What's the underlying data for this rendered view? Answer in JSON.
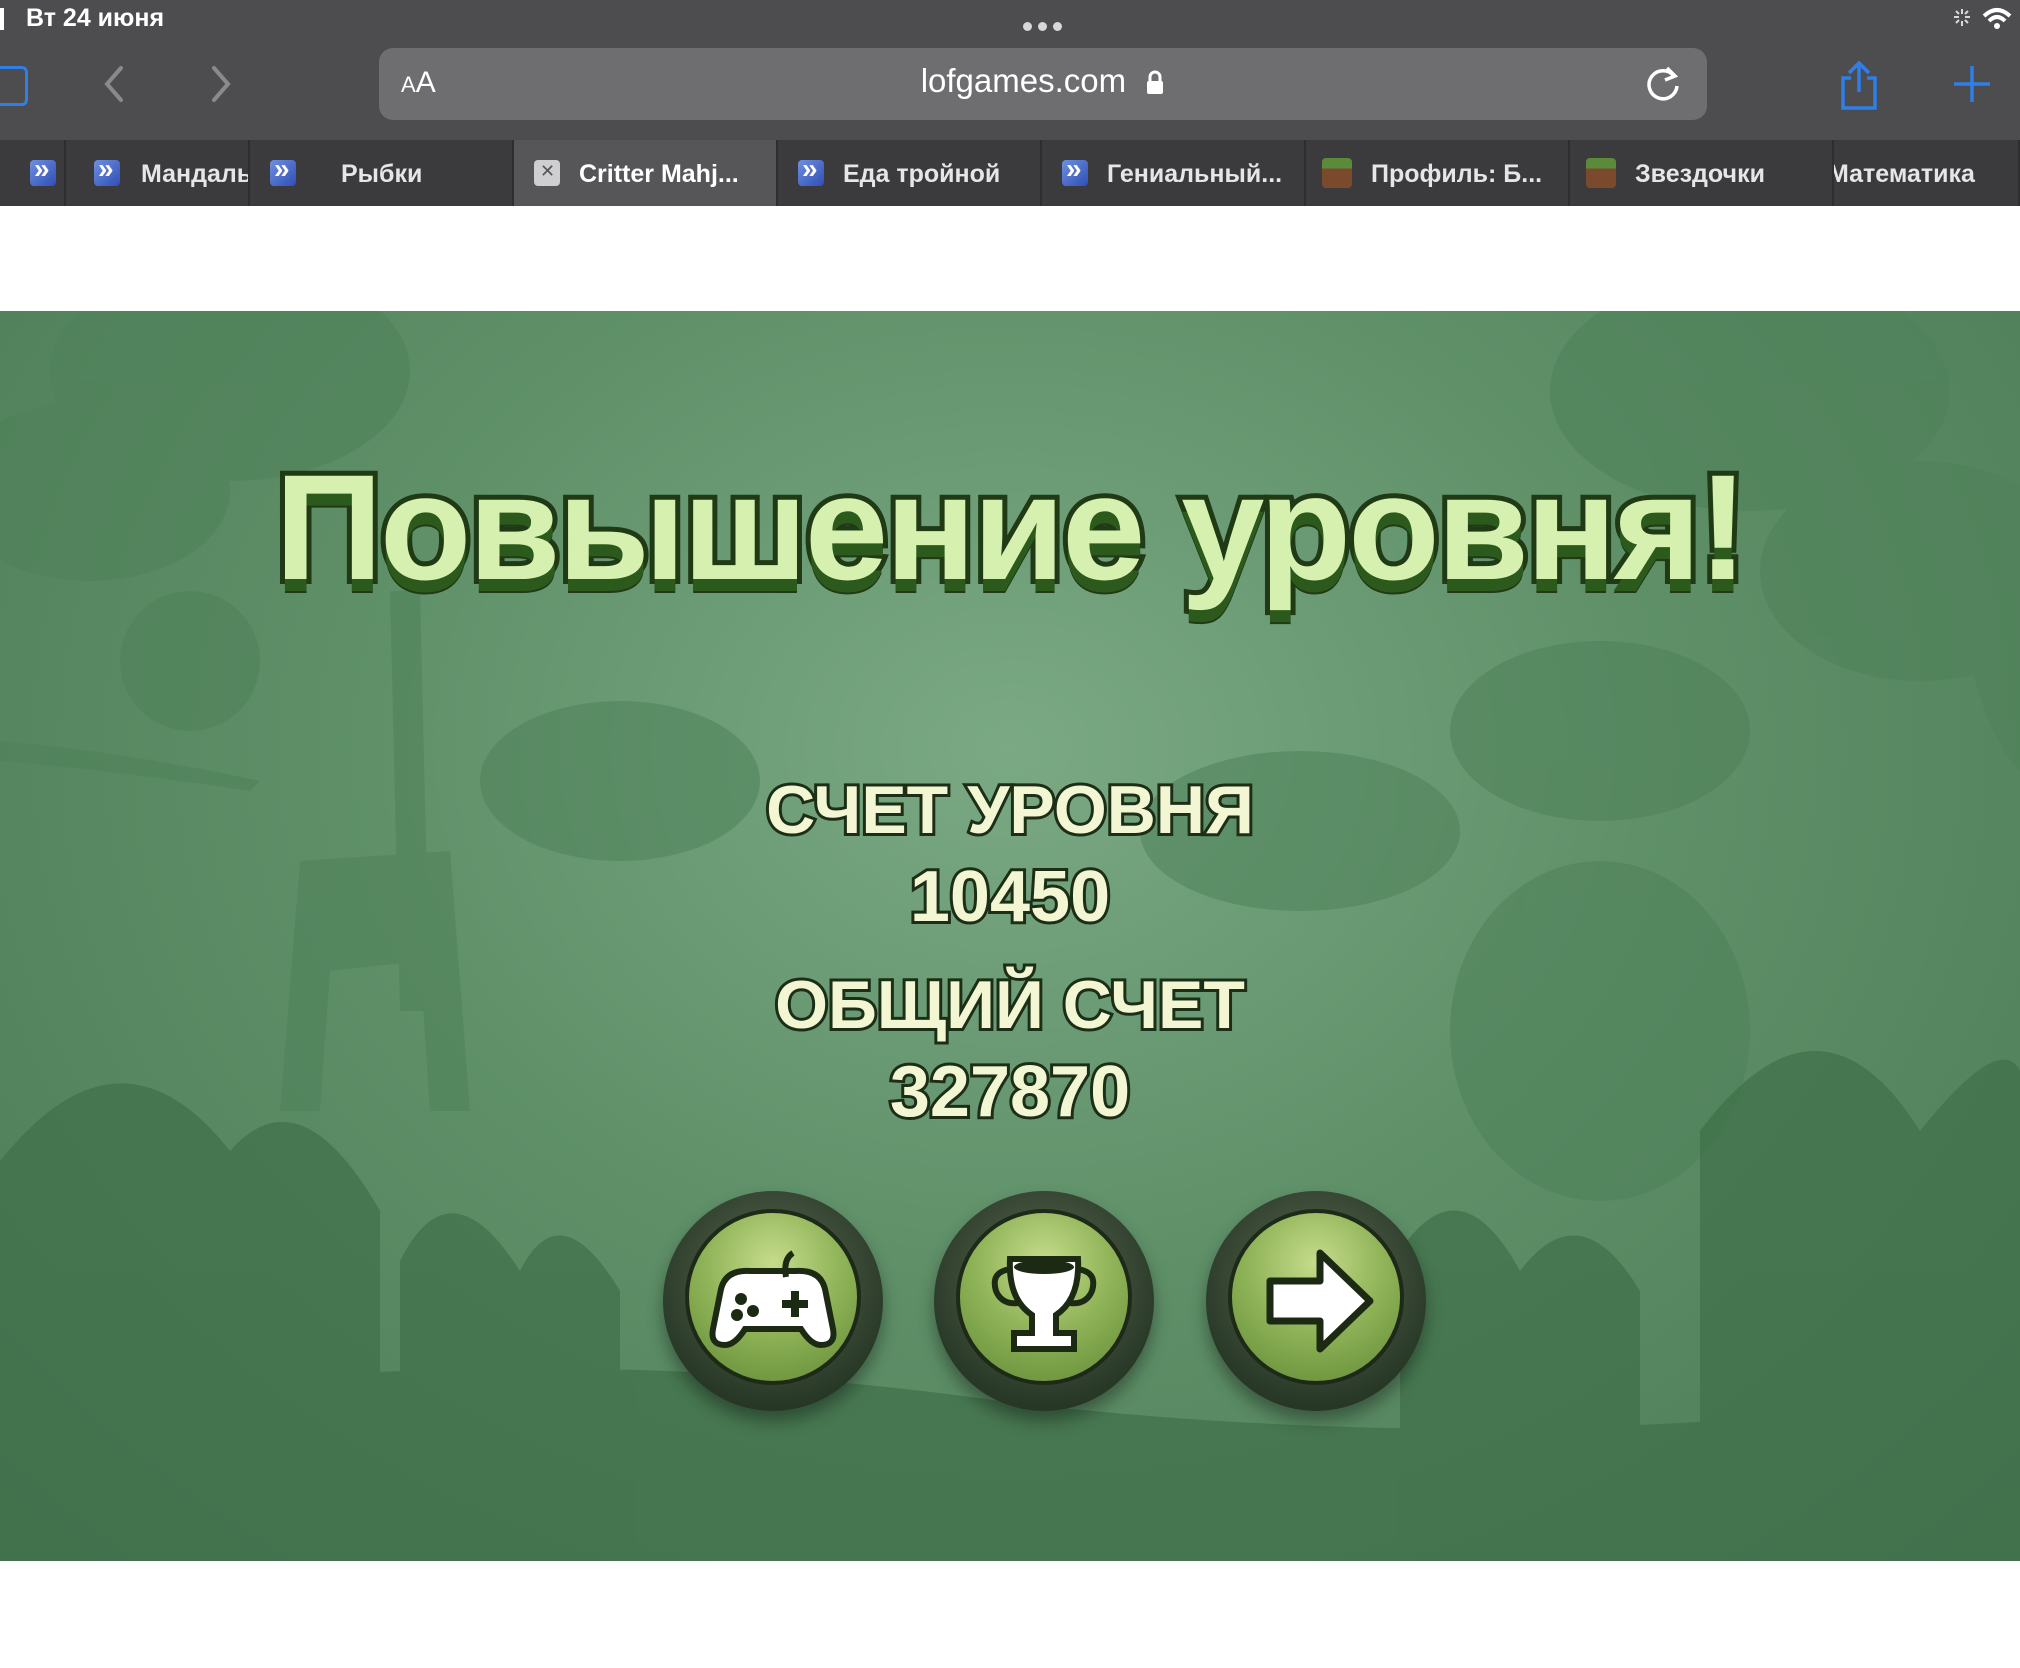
{
  "status_bar": {
    "date": "Вт 24 июня"
  },
  "toolbar": {
    "reader_label_small": "A",
    "reader_label_large": "A",
    "url": "lofgames.com"
  },
  "tabs": [
    {
      "label": "",
      "icon": "game-blue-icon"
    },
    {
      "label": "Мандаль",
      "icon": "game-blue-icon"
    },
    {
      "label": "Рыбки",
      "icon": "game-blue-icon"
    },
    {
      "label": "Critter Mahj...",
      "icon": "close-icon",
      "active": true
    },
    {
      "label": "Еда тройной",
      "icon": "game-blue-icon"
    },
    {
      "label": "Гениальный...",
      "icon": "game-blue-icon"
    },
    {
      "label": "Профиль: Б...",
      "icon": "minecraft-icon"
    },
    {
      "label": "Звездочки",
      "icon": "minecraft-icon"
    },
    {
      "label": "Математика",
      "icon": ""
    }
  ],
  "game": {
    "title": "Повышение уровня!",
    "level_score_label": "СЧЕТ УРОВНЯ",
    "level_score_value": "10450",
    "total_score_label": "ОБЩИЙ СЧЕТ",
    "total_score_value": "327870",
    "buttons": [
      "gamepad-icon",
      "trophy-icon",
      "arrow-right-icon"
    ],
    "colors": {
      "background": "#5f9068",
      "title_fill": "#d6f0b0",
      "button_fill": "#92b55a"
    }
  }
}
